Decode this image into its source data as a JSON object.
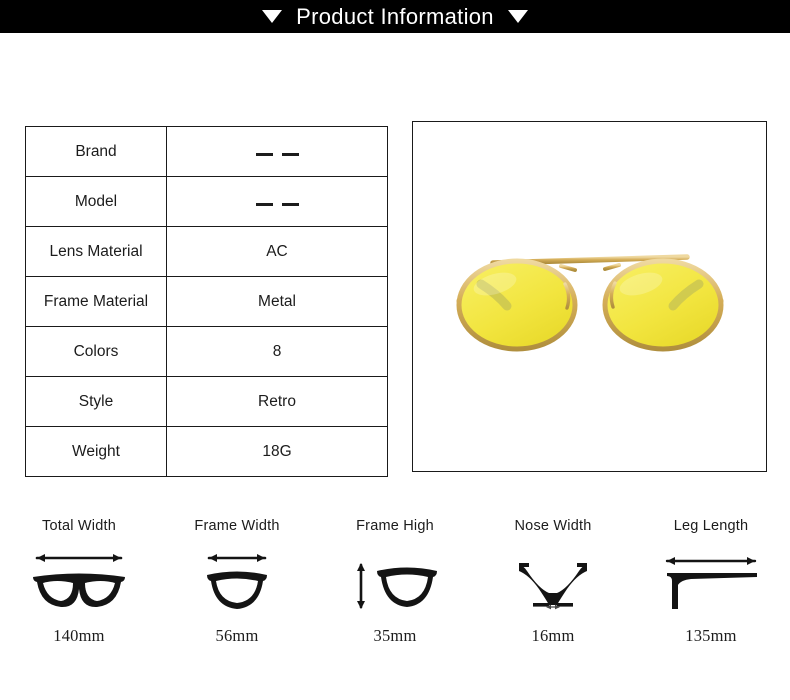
{
  "header": {
    "title": "Product Information",
    "left_marker": "triangle-down",
    "right_marker": "triangle-down",
    "background": "#000000",
    "text_color": "#ffffff"
  },
  "spec_table": {
    "rows": [
      {
        "label": "Brand",
        "value": "——",
        "value_kind": "dashes"
      },
      {
        "label": "Model",
        "value": "——",
        "value_kind": "dashes"
      },
      {
        "label": "Lens Material",
        "value": "AC",
        "value_kind": "text"
      },
      {
        "label": "Frame Material",
        "value": "Metal",
        "value_kind": "text"
      },
      {
        "label": "Colors",
        "value": "8",
        "value_kind": "text"
      },
      {
        "label": "Style",
        "value": "Retro",
        "value_kind": "text"
      },
      {
        "label": "Weight",
        "value": "18G",
        "value_kind": "text"
      }
    ]
  },
  "product_photo": {
    "alt": "oval retro sunglasses with yellow lenses and gold metal frame",
    "lens_color": "#f2e743",
    "frame_color": "#d8b35a",
    "background": "#ffffff"
  },
  "measurements": [
    {
      "label": "Total Width",
      "value": "140mm",
      "icon": "glasses-front-icon",
      "arrow": "horizontal"
    },
    {
      "label": "Frame Width",
      "value": "56mm",
      "icon": "single-lens-icon",
      "arrow": "horizontal"
    },
    {
      "label": "Frame High",
      "value": "35mm",
      "icon": "single-lens-height-icon",
      "arrow": "vertical"
    },
    {
      "label": "Nose Width",
      "value": "16mm",
      "icon": "nose-bridge-icon",
      "arrow": "horizontal-small"
    },
    {
      "label": "Leg Length",
      "value": "135mm",
      "icon": "temple-arm-icon",
      "arrow": "horizontal"
    }
  ]
}
